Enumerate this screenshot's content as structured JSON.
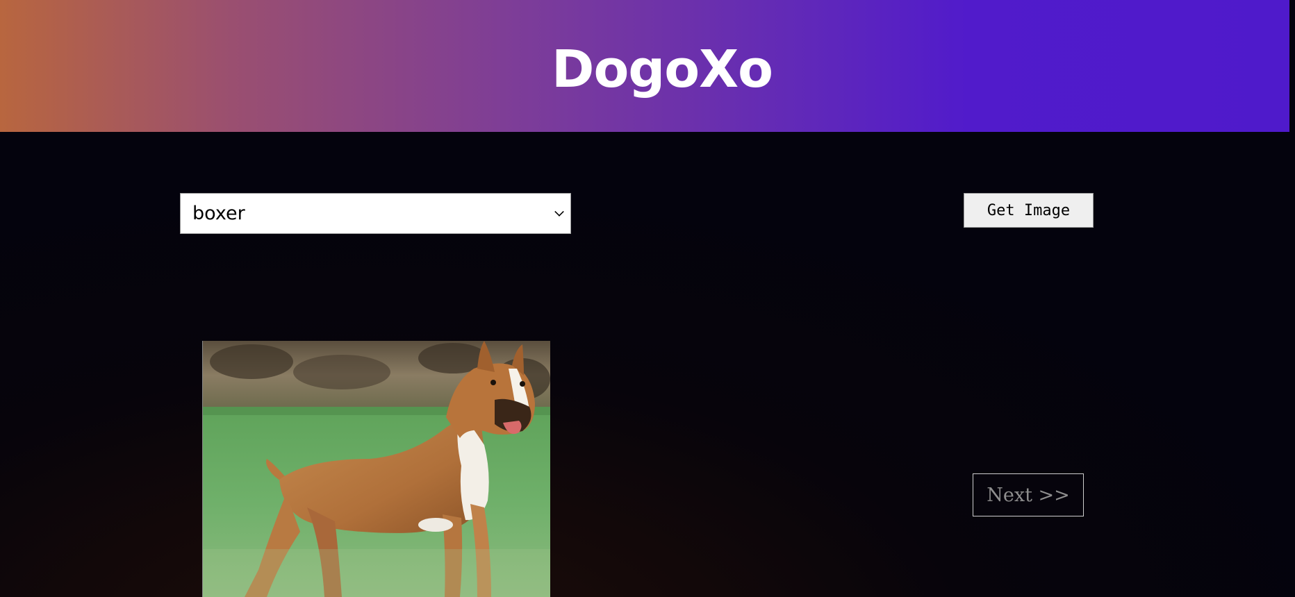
{
  "header": {
    "logo_text": "DogoXo",
    "gradient_colors": [
      "#b8663f",
      "#7d3d98",
      "#511bcb"
    ]
  },
  "breed_select": {
    "selected_value": "boxer"
  },
  "get_image_button": {
    "label": "Get Image"
  },
  "next_button": {
    "label": "Next  >>"
  },
  "dog_image": {
    "subject": "boxer dog standing on grass"
  },
  "colors": {
    "page_background": "#04030d",
    "text_on_header": "#ffffff",
    "next_text": "#8e8e8e"
  }
}
